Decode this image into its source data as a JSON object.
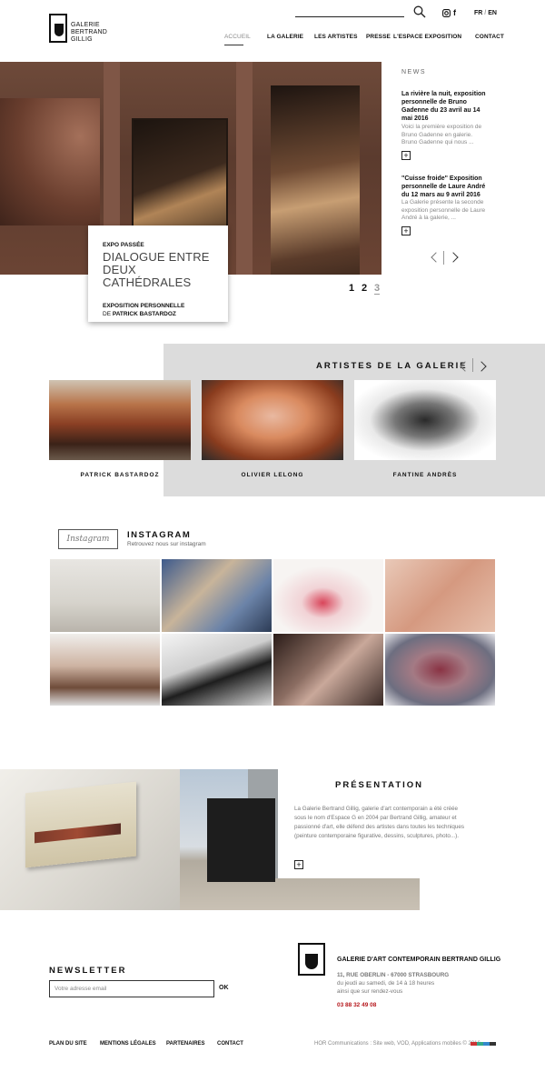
{
  "header": {
    "logo_lines": [
      "GALERIE",
      "BERTRAND",
      "GILLIG"
    ],
    "search": {
      "icon": "search-icon"
    },
    "social": {
      "instagram_icon": "instagram-icon",
      "facebook_icon": "facebook-icon",
      "facebook_glyph": "f"
    },
    "lang": {
      "fr": "FR",
      "sep": "/",
      "en": "EN"
    },
    "nav": [
      "ACCUEIL",
      "LA GALERIE",
      "LES ARTISTES",
      "PRESSE",
      "L'ESPACE EXPOSITION",
      "CONTACT"
    ]
  },
  "hero": {
    "card": {
      "kicker": "EXPO PASSÉE",
      "title_line1": "DIALOGUE ENTRE DEUX",
      "title_line2": "CATHÉDRALES",
      "sub1": "EXPOSITION PERSONNELLE",
      "sub2_prefix": "DE",
      "sub2_name": "PATRICK BASTARDOZ"
    },
    "pager": [
      "1",
      "2",
      "3"
    ]
  },
  "news": {
    "heading": "NEWS",
    "items": [
      {
        "title": "La rivière la nuit, exposition personnelle de Bruno Gadenne du 23 avril au 14 mai 2016",
        "excerpt": "Voici la première exposition de Bruno Gadenne en galerie. Bruno Gadenne qui nous ..."
      },
      {
        "title": "\"Cuisse froide\" Exposition personnelle de Laure André du 12 mars au 9 avril 2016",
        "excerpt": "La Galerie présente la seconde exposition personnelle de Laure André à la galerie, ..."
      }
    ],
    "plus": "+"
  },
  "artists": {
    "heading": "ARTISTES DE LA GALERIE",
    "list": [
      {
        "name": "PATRICK BASTARDOZ"
      },
      {
        "name": "OLIVIER LELONG"
      },
      {
        "name": "FANTINE ANDRÈS"
      }
    ]
  },
  "instagram": {
    "logo": "Instagram",
    "heading": "INSTAGRAM",
    "sub": "Retrouvez nous sur instagram"
  },
  "presentation": {
    "heading": "PRÉSENTATION",
    "text": "La Galerie Bertrand Gillig, galerie d'art contemporain a été créée sous le nom d'Espace G en 2004 par Bertrand Gillig, amateur et passionné d'art, elle défend des artistes dans toutes les techniques (peinture contemporaine figurative, dessins, sculptures, photo...).",
    "plus": "+"
  },
  "newsletter": {
    "heading": "NEWSLETTER",
    "placeholder": "Votre adresse email",
    "ok": "OK"
  },
  "footer": {
    "name": "GALERIE D'ART CONTEMPORAIN BERTRAND GILLIG",
    "address_bold": "11, RUE OBERLIN - 67000 STRASBOURG",
    "hours1": "du jeudi au samedi, de 14 à 18 heures",
    "hours2": "ainsi que sur rendez-vous",
    "phone": "03 88 32 49 08",
    "links": [
      "PLAN DU SITE",
      "MENTIONS LÉGALES",
      "PARTENAIRES",
      "CONTACT"
    ],
    "credit": "HOR Communications : Site web, VOD, Applications mobiles © 2016"
  }
}
